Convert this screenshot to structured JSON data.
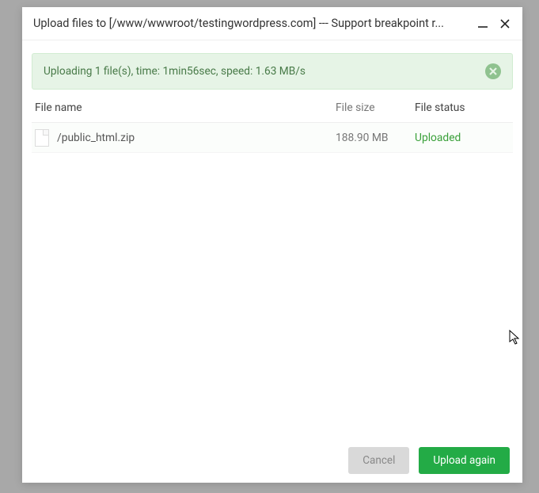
{
  "title": "Upload files to [/www/wwwroot/testingwordpress.com] --- Support breakpoint r...",
  "alert": {
    "text": "Uploading 1 file(s), time: 1min56sec, speed: 1.63 MB/s"
  },
  "columns": {
    "name": "File name",
    "size": "File size",
    "status": "File status"
  },
  "rows": [
    {
      "name": "/public_html.zip",
      "size": "188.90 MB",
      "status": "Uploaded"
    }
  ],
  "buttons": {
    "cancel": "Cancel",
    "upload_again": "Upload again"
  }
}
